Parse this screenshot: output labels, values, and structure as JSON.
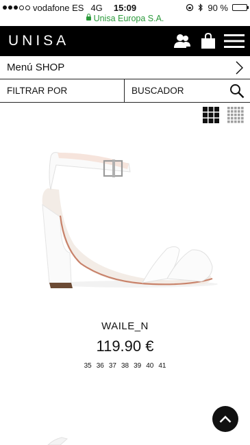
{
  "status_bar": {
    "carrier": "vodafone ES",
    "network": "4G",
    "time": "15:09",
    "battery_percent": "90 %",
    "battery_level": 0.9,
    "url": "Unisa Europa S.A.",
    "signal_bars_filled": 3,
    "signal_bars_total": 5
  },
  "header": {
    "logo_text": "UNISA",
    "icons": [
      "user-icon",
      "shopping-bag-icon",
      "hamburger-menu-icon"
    ]
  },
  "menu_shop": {
    "label": "Menú SHOP"
  },
  "filters": {
    "filter_label": "FILTRAR POR",
    "search_label": "BUSCADOR"
  },
  "view_toggle": {
    "options": [
      "grid-large-icon",
      "grid-small-icon"
    ],
    "selected": "grid-large-icon"
  },
  "product": {
    "name": "WAILE_N",
    "price": "119.90 €",
    "sizes": [
      "35",
      "36",
      "37",
      "38",
      "39",
      "40",
      "41"
    ]
  },
  "colors": {
    "header_bg": "#000000",
    "url_green": "#2a9a3a",
    "battery": "#f2b705"
  }
}
